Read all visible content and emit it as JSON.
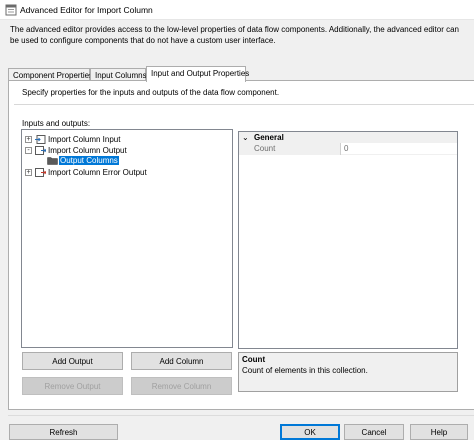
{
  "window": {
    "title": "Advanced Editor for Import Column",
    "description": "The advanced editor provides access to the low-level properties of data flow components. Additionally, the advanced editor can be used to configure components that do not have a custom user interface."
  },
  "tabs": [
    {
      "label": "Component Properties",
      "active": false
    },
    {
      "label": "Input Columns",
      "active": false
    },
    {
      "label": "Input and Output Properties",
      "active": true
    }
  ],
  "panel": {
    "hint": "Specify properties for the inputs and outputs of the data flow component.",
    "io_label": "Inputs and outputs:"
  },
  "tree": {
    "nodes": [
      {
        "label": "Import Column Input",
        "expander": "+",
        "level": 0
      },
      {
        "label": "Import Column Output",
        "expander": "-",
        "level": 0
      },
      {
        "label": "Output Columns",
        "expander": "",
        "level": 1,
        "selected": true
      },
      {
        "label": "Import Column Error Output",
        "expander": "+",
        "level": 0
      }
    ]
  },
  "properties": {
    "category": "General",
    "category_toggle": "⌄",
    "rows": [
      {
        "name": "Count",
        "value": "0"
      }
    ],
    "help_title": "Count",
    "help_text": "Count of elements in this collection."
  },
  "buttons": {
    "add_output": "Add Output",
    "add_column": "Add Column",
    "remove_output": "Remove Output",
    "remove_column": "Remove Column",
    "refresh": "Refresh",
    "ok": "OK",
    "cancel": "Cancel",
    "help": "Help"
  },
  "colors": {
    "selection": "#0078d7",
    "window_bg": "#f0f0f0"
  }
}
